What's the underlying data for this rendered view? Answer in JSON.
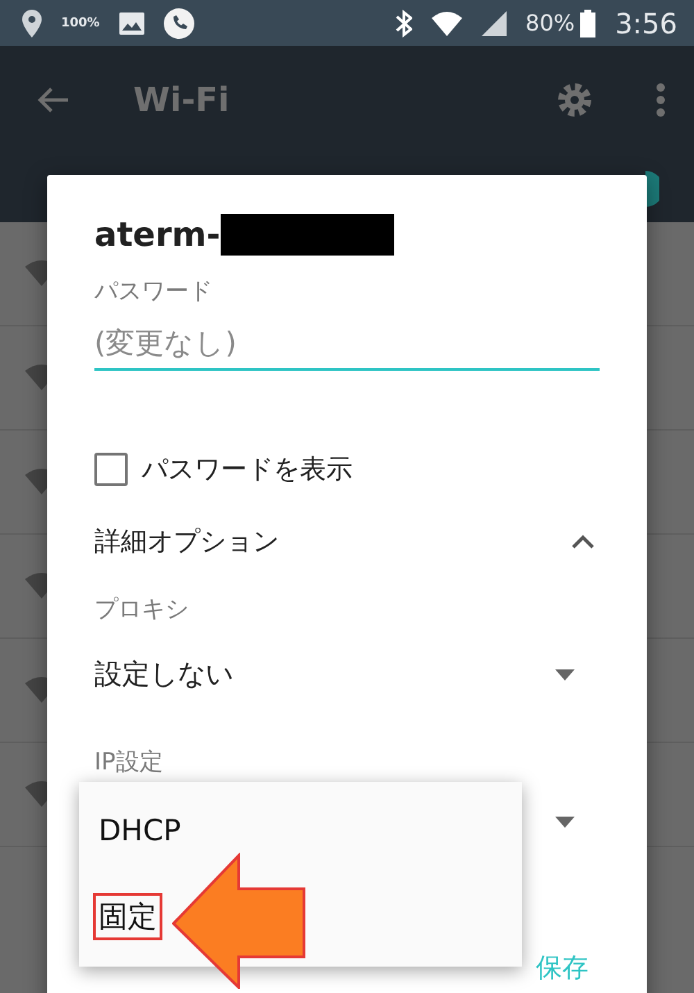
{
  "status_bar": {
    "saver_badge": "100%",
    "battery": "80%",
    "time": "3:56"
  },
  "app_bar": {
    "title": "Wi-Fi"
  },
  "wifi_switch": {
    "on": true
  },
  "dialog": {
    "title": "aterm-",
    "password_label": "パスワード",
    "password_placeholder": "(変更なし)",
    "show_password": {
      "label": "パスワードを表示",
      "checked": false
    },
    "advanced": {
      "label": "詳細オプション",
      "expanded": true
    },
    "proxy": {
      "label": "プロキシ",
      "value": "設定しない"
    },
    "ip": {
      "label": "IP設定"
    },
    "save_button": "保存"
  },
  "ip_menu": {
    "items": [
      {
        "label": "DHCP",
        "highlighted": false
      },
      {
        "label": "固定",
        "highlighted": true
      }
    ]
  }
}
